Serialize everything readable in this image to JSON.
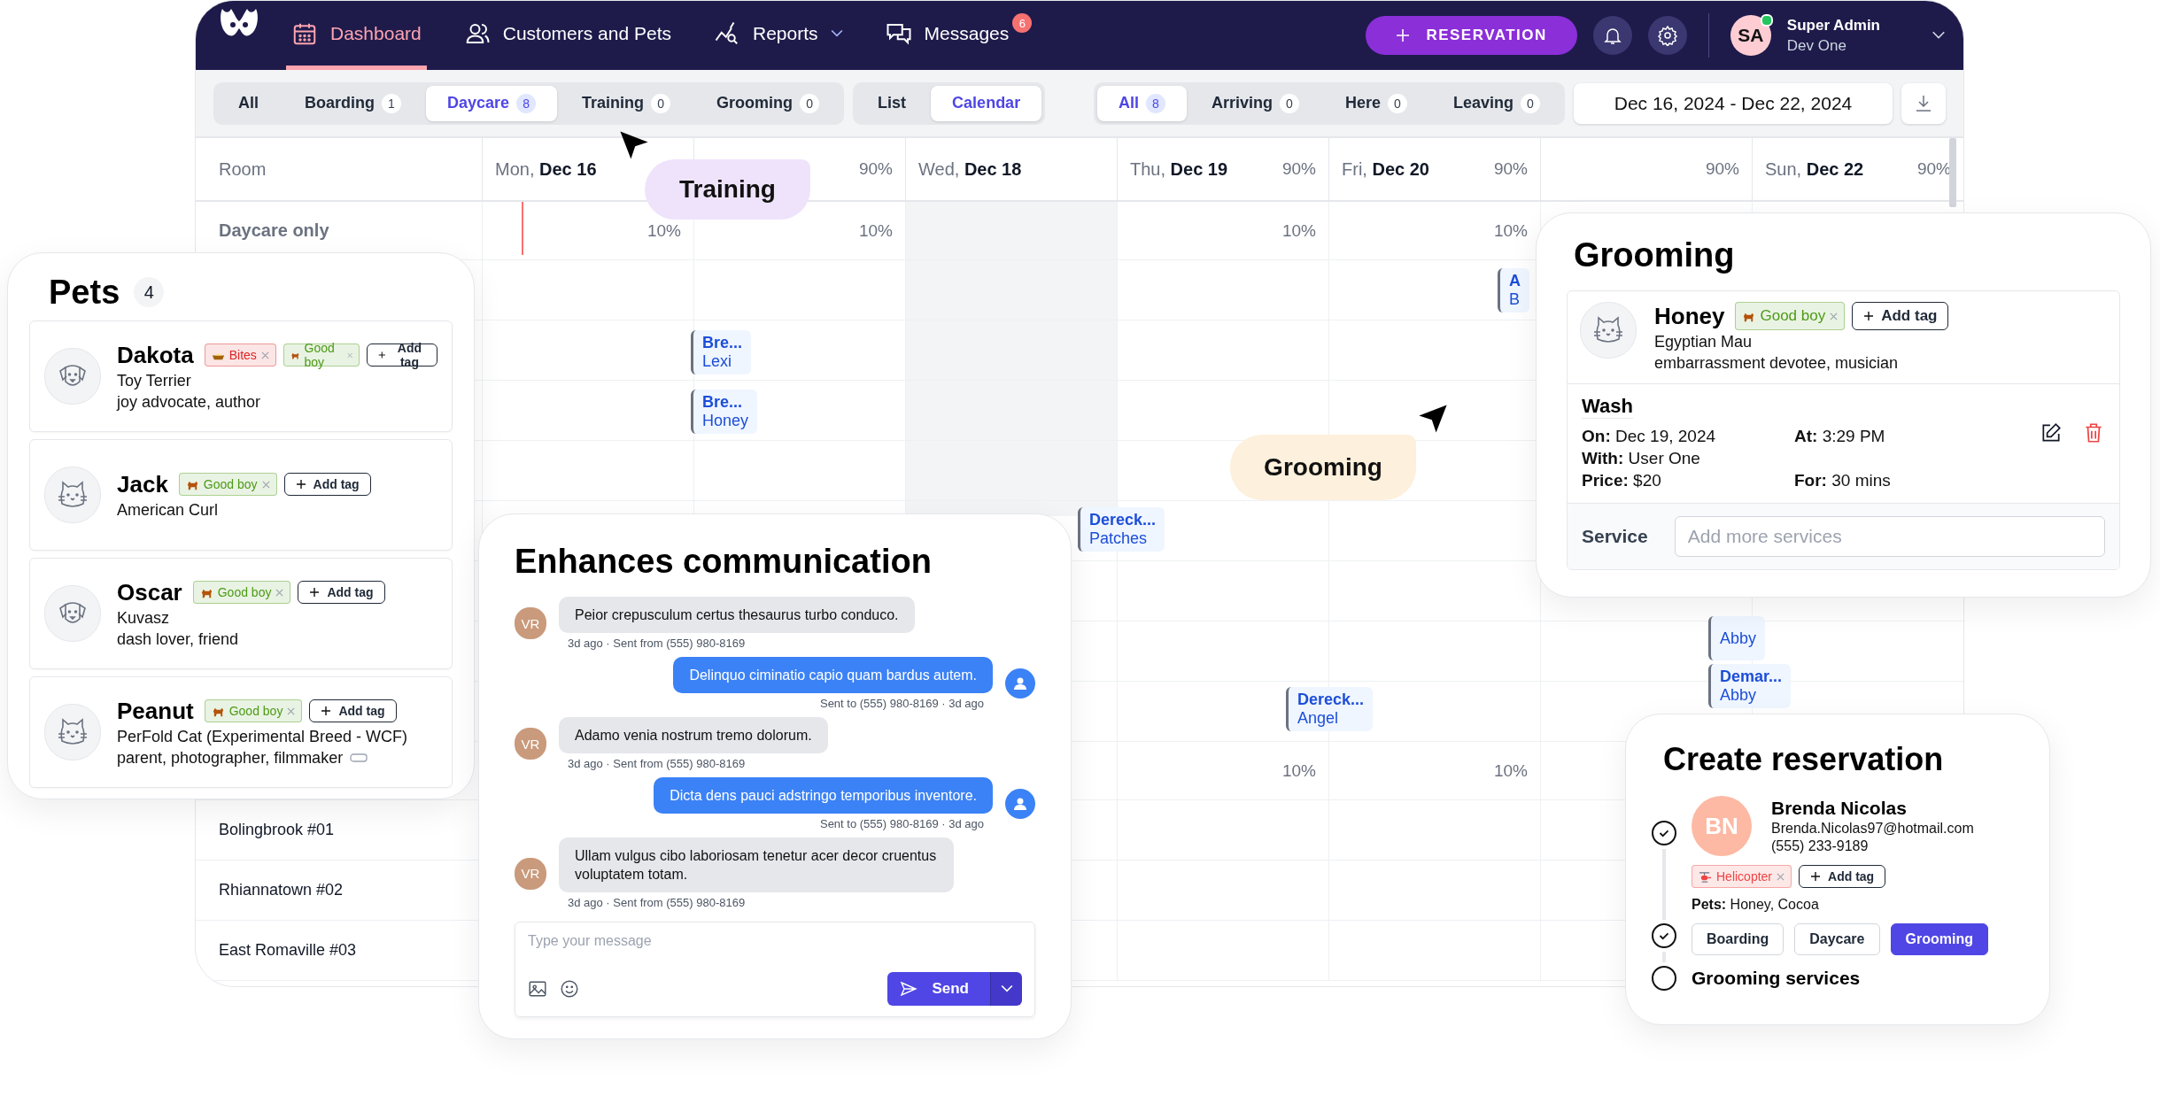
{
  "nav": {
    "items": [
      {
        "label": "Dashboard",
        "selected": true
      },
      {
        "label": "Customers and Pets",
        "selected": false
      },
      {
        "label": "Reports",
        "selected": false,
        "dropdown": true
      },
      {
        "label": "Messages",
        "selected": false,
        "badge": "6"
      }
    ],
    "reservation_button": "RESERVATION",
    "user": {
      "initials": "SA",
      "name": "Super Admin",
      "subtitle": "Dev One",
      "online": true
    }
  },
  "filters": {
    "services": [
      {
        "label": "All",
        "selected": false
      },
      {
        "label": "Boarding",
        "count": "1",
        "selected": false
      },
      {
        "label": "Daycare",
        "count": "8",
        "selected": true
      },
      {
        "label": "Training",
        "count": "0",
        "selected": false
      },
      {
        "label": "Grooming",
        "count": "0",
        "selected": false
      }
    ],
    "views": [
      {
        "label": "List",
        "selected": false
      },
      {
        "label": "Calendar",
        "selected": true
      }
    ],
    "statuses": [
      {
        "label": "All",
        "count": "8",
        "selected": true
      },
      {
        "label": "Arriving",
        "count": "0",
        "selected": false
      },
      {
        "label": "Here",
        "count": "0",
        "selected": false
      },
      {
        "label": "Leaving",
        "count": "0",
        "selected": false
      }
    ],
    "date_range": "Dec 16, 2024 - Dec 22, 2024"
  },
  "calendar": {
    "room_header": "Room",
    "days": [
      {
        "label": "Mon, **Dec 16**",
        "shaded": false
      },
      {
        "percent": "90%",
        "shaded": false
      },
      {
        "label": "Wed, **Dec 18**",
        "shaded": true
      },
      {
        "label": "Thu, **Dec 19**",
        "percent": "90%",
        "shaded": false
      },
      {
        "label": "Fri, **Dec 20**",
        "percent": "90%",
        "shaded": false
      },
      {
        "percent": "90%",
        "shaded": false
      },
      {
        "label": "Sun, **Dec 22**",
        "percent": "90%",
        "shaded": false
      }
    ],
    "rows": [
      {
        "kind": "category",
        "label": "Daycare only",
        "cells": [
          {
            "percent": "10%"
          },
          {
            "percent": "10%"
          },
          {},
          {
            "percent": "10%"
          },
          {
            "percent": "10%"
          },
          {},
          {}
        ]
      },
      {
        "kind": "room"
      },
      {
        "kind": "room"
      },
      {
        "kind": "room"
      },
      {
        "kind": "room"
      },
      {
        "kind": "room"
      },
      {
        "kind": "room"
      },
      {
        "kind": "room"
      },
      {
        "kind": "room"
      },
      {
        "kind": "category",
        "cells": [
          {},
          {},
          {},
          {
            "percent": "10%"
          },
          {
            "percent": "10%"
          },
          {},
          {}
        ]
      },
      {
        "kind": "room",
        "label": "Bolingbrook #01"
      },
      {
        "kind": "room",
        "label": "Rhiannatown #02"
      },
      {
        "kind": "room",
        "label": "East Romaville #03"
      }
    ],
    "events": [
      {
        "title": "Bre...",
        "pet": "Lexi"
      },
      {
        "title": "Bre...",
        "pet": "Honey"
      },
      {
        "title": "Dereck...",
        "pet": "Patches"
      },
      {
        "title": "Dereck...",
        "pet": "Angel"
      },
      {
        "title": "A",
        "pet": "B"
      },
      {
        "pet": "Abby"
      },
      {
        "title": "Demar...",
        "pet": "Abby"
      }
    ]
  },
  "callouts": [
    {
      "label": "Training",
      "color": "#efe3fb"
    },
    {
      "label": "Grooming",
      "color": "#fdf0dc"
    }
  ],
  "pets_card": {
    "title": "Pets",
    "count": "4",
    "pets": [
      {
        "kind": "dog",
        "name": "Dakota",
        "tags": [
          {
            "label": "Bites",
            "kind": "alert",
            "color": "#dc2626"
          },
          {
            "label": "Good boy",
            "kind": "praise",
            "color": "#4d9a16"
          }
        ],
        "add_tag_button": "Add tag",
        "breed": "Toy Terrier",
        "description": "joy advocate, author"
      },
      {
        "kind": "cat",
        "name": "Jack",
        "tags": [
          {
            "label": "Good boy",
            "kind": "praise",
            "color": "#4d9a16"
          }
        ],
        "add_tag_button": "Add tag",
        "breed": "American Curl"
      },
      {
        "kind": "dog",
        "name": "Oscar",
        "tags": [
          {
            "label": "Good boy",
            "kind": "praise",
            "color": "#4d9a16"
          }
        ],
        "add_tag_button": "Add tag",
        "breed": "Kuvasz",
        "description": "dash lover, friend"
      },
      {
        "kind": "cat",
        "name": "Peanut",
        "tags": [
          {
            "label": "Good boy",
            "kind": "praise",
            "color": "#4d9a16"
          }
        ],
        "add_tag_button": "Add tag",
        "breed": "PerFold Cat (Experimental Breed - WCF)",
        "description": "parent, photographer, filmmaker",
        "note_icon": true
      }
    ]
  },
  "messages_card": {
    "title": "Enhances communication",
    "messages": [
      {
        "kind": "incoming",
        "initials": "VR",
        "text": "Peior crepusculum certus thesaurus turbo conduco.",
        "meta": "3d ago · Sent from (555) 980-8169"
      },
      {
        "kind": "outgoing",
        "text": "Delinquo ciminatio capio quam bardus autem.",
        "meta": "Sent to (555) 980-8169 · 3d ago"
      },
      {
        "kind": "incoming",
        "initials": "VR",
        "text": "Adamo venia nostrum tremo dolorum.",
        "meta": "3d ago · Sent from (555) 980-8169"
      },
      {
        "kind": "outgoing",
        "text": "Dicta dens pauci adstringo temporibus inventore.",
        "meta": "Sent to (555) 980-8169 · 3d ago"
      },
      {
        "kind": "incoming",
        "initials": "VR",
        "text": "Ullam vulgus cibo laboriosam tenetur acer decor cruentus voluptatem totam.",
        "meta": "3d ago · Sent from (555) 980-8169"
      }
    ],
    "input_placeholder": "Type your message",
    "send_button": "Send"
  },
  "grooming_card": {
    "title": "Grooming",
    "pet": {
      "kind": "cat",
      "name": "Honey",
      "tags": [
        {
          "label": "Good boy",
          "kind": "praise",
          "color": "#4d9a16"
        }
      ],
      "add_tag_button": "Add tag",
      "breed": "Egyptian Mau",
      "description": "embarrassment devotee, musician"
    },
    "service_name": "Wash",
    "details": [
      [
        "**On:** Dec 19, 2024",
        "**At:** 3:29 PM"
      ],
      [
        "**With:** User One"
      ],
      [
        "**Price:** $20",
        "**For:** 30 mins"
      ]
    ],
    "service_label": "Service",
    "service_placeholder": "Add more services"
  },
  "reservation_card": {
    "title": "Create reservation",
    "steps": [
      {
        "kind": "customer",
        "done": true,
        "initials": "BN",
        "name": "Brenda Nicolas",
        "email": "Brenda.Nicolas97@hotmail.com",
        "phone": "(555) 233-9189",
        "tags": [
          {
            "label": "Helicopter",
            "kind": "vehicle",
            "color": "#ef4444"
          }
        ],
        "add_tag_button": "Add tag",
        "pets": "**Pets:** Honey, Cocoa"
      },
      {
        "kind": "services",
        "done": true,
        "options": [
          {
            "label": "Boarding",
            "selected": false
          },
          {
            "label": "Daycare",
            "selected": false
          },
          {
            "label": "Grooming",
            "selected": true
          }
        ]
      },
      {
        "kind": "heading",
        "done": false,
        "label": "Grooming services"
      }
    ]
  }
}
